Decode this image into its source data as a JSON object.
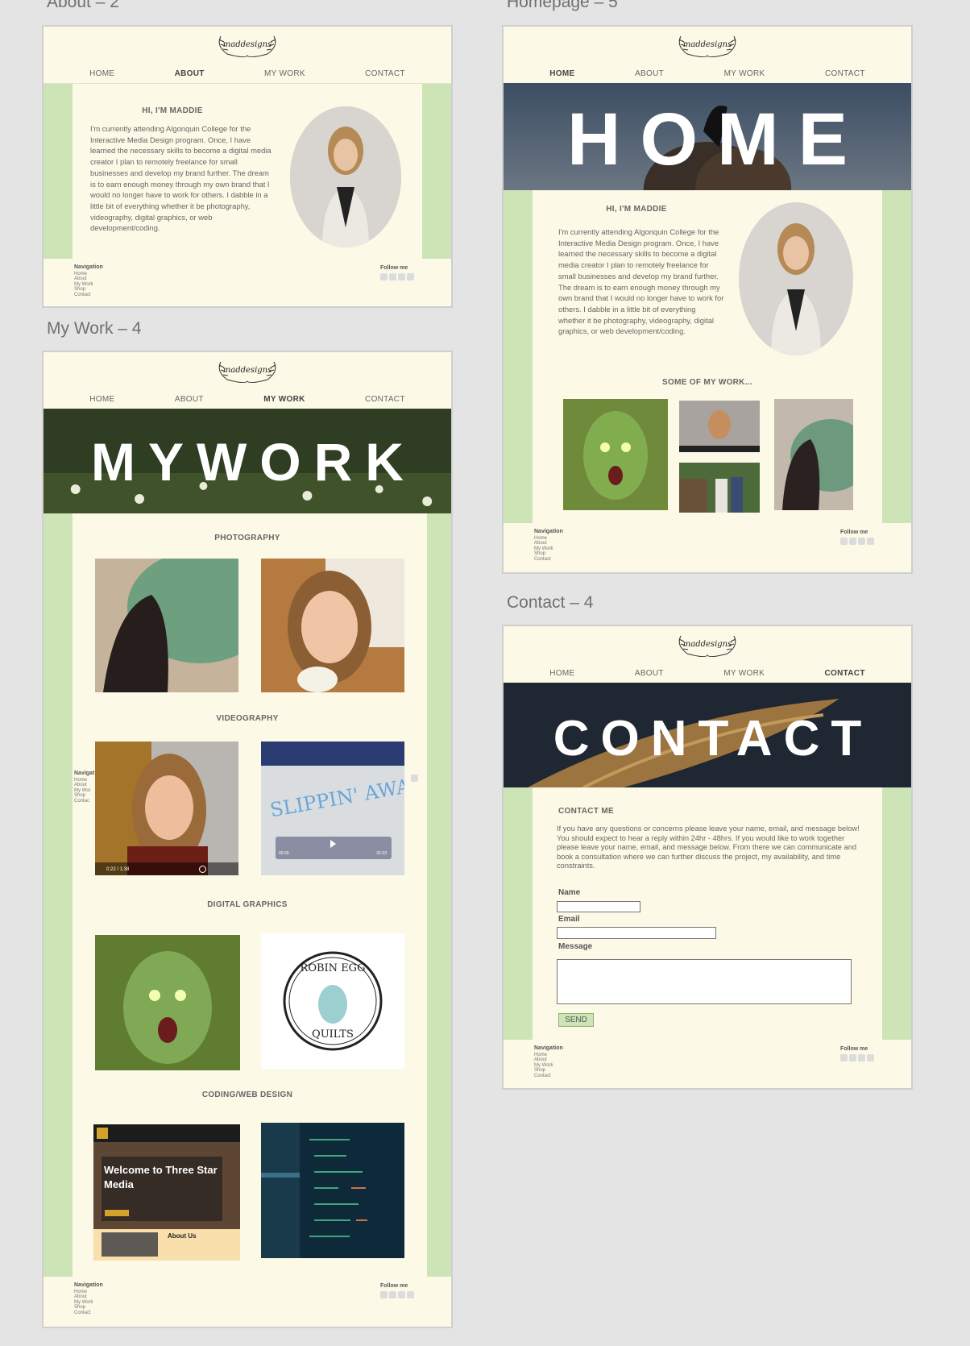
{
  "canvas_labels": {
    "about": "About – 2",
    "homepage": "Homepage – 5",
    "mywork": "My Work – 4",
    "contact": "Contact – 4"
  },
  "brand": {
    "logo_text": "maddesigns"
  },
  "nav": {
    "home": "HOME",
    "about": "ABOUT",
    "mywork": "MY WORK",
    "contact": "CONTACT"
  },
  "intro": {
    "heading": "HI, I'M MADDIE",
    "body": "I'm currently attending Algonquin College for the Interactive Media Design program. Once, I have learned the necessary skills to become a digital media creator I plan to remotely freelance for small businesses and develop my brand further. The dream is to earn enough money through my own brand that I would no longer have to work for others. I dabble in a little bit of everything whether it be photography, videography, digital graphics, or web development/coding."
  },
  "home": {
    "hero_title": "HOME",
    "work_heading": "SOME OF MY WORK..."
  },
  "mywork": {
    "hero_title": "MYWORK",
    "photography": "PHOTOGRAPHY",
    "videography": "VIDEOGRAPHY",
    "digital_graphics": "DIGITAL GRAPHICS",
    "coding": "CODING/WEB DESIGN",
    "video1_time": "0:22 / 1:38",
    "video2_sign": "SLIPPIN' AWAY",
    "video2_start": "00:00",
    "video2_end": "01:03",
    "robin_top": "ROBIN EGG",
    "robin_bottom": "QUILTS",
    "web_welcome": "Welcome to Three Star Media",
    "web_about": "About Us"
  },
  "contact": {
    "hero_title": "CONTACT",
    "heading": "CONTACT ME",
    "body": "If you have any questions or concerns please leave your name, email, and message below! You should expect to hear a reply within 24hr - 48hrs. If you would like to work together please leave your name, email, and message below. From there we can communicate and book a consultation where we can further discuss the project, my availability, and time constraints.",
    "name_label": "Name",
    "email_label": "Email",
    "message_label": "Message",
    "send": "SEND"
  },
  "footer": {
    "nav_title": "Navigation",
    "links": [
      "Home",
      "About",
      "My Work",
      "Shop",
      "Contact"
    ],
    "follow": "Follow me",
    "overlap_links": [
      "Navigat",
      "Home",
      "About",
      "My Wor",
      "Shop",
      "Contac"
    ]
  },
  "colors": {
    "cream": "#fcf9e6",
    "green": "#cde5b6",
    "border": "#cfcfcf",
    "canvas": "#e4e4e4"
  }
}
